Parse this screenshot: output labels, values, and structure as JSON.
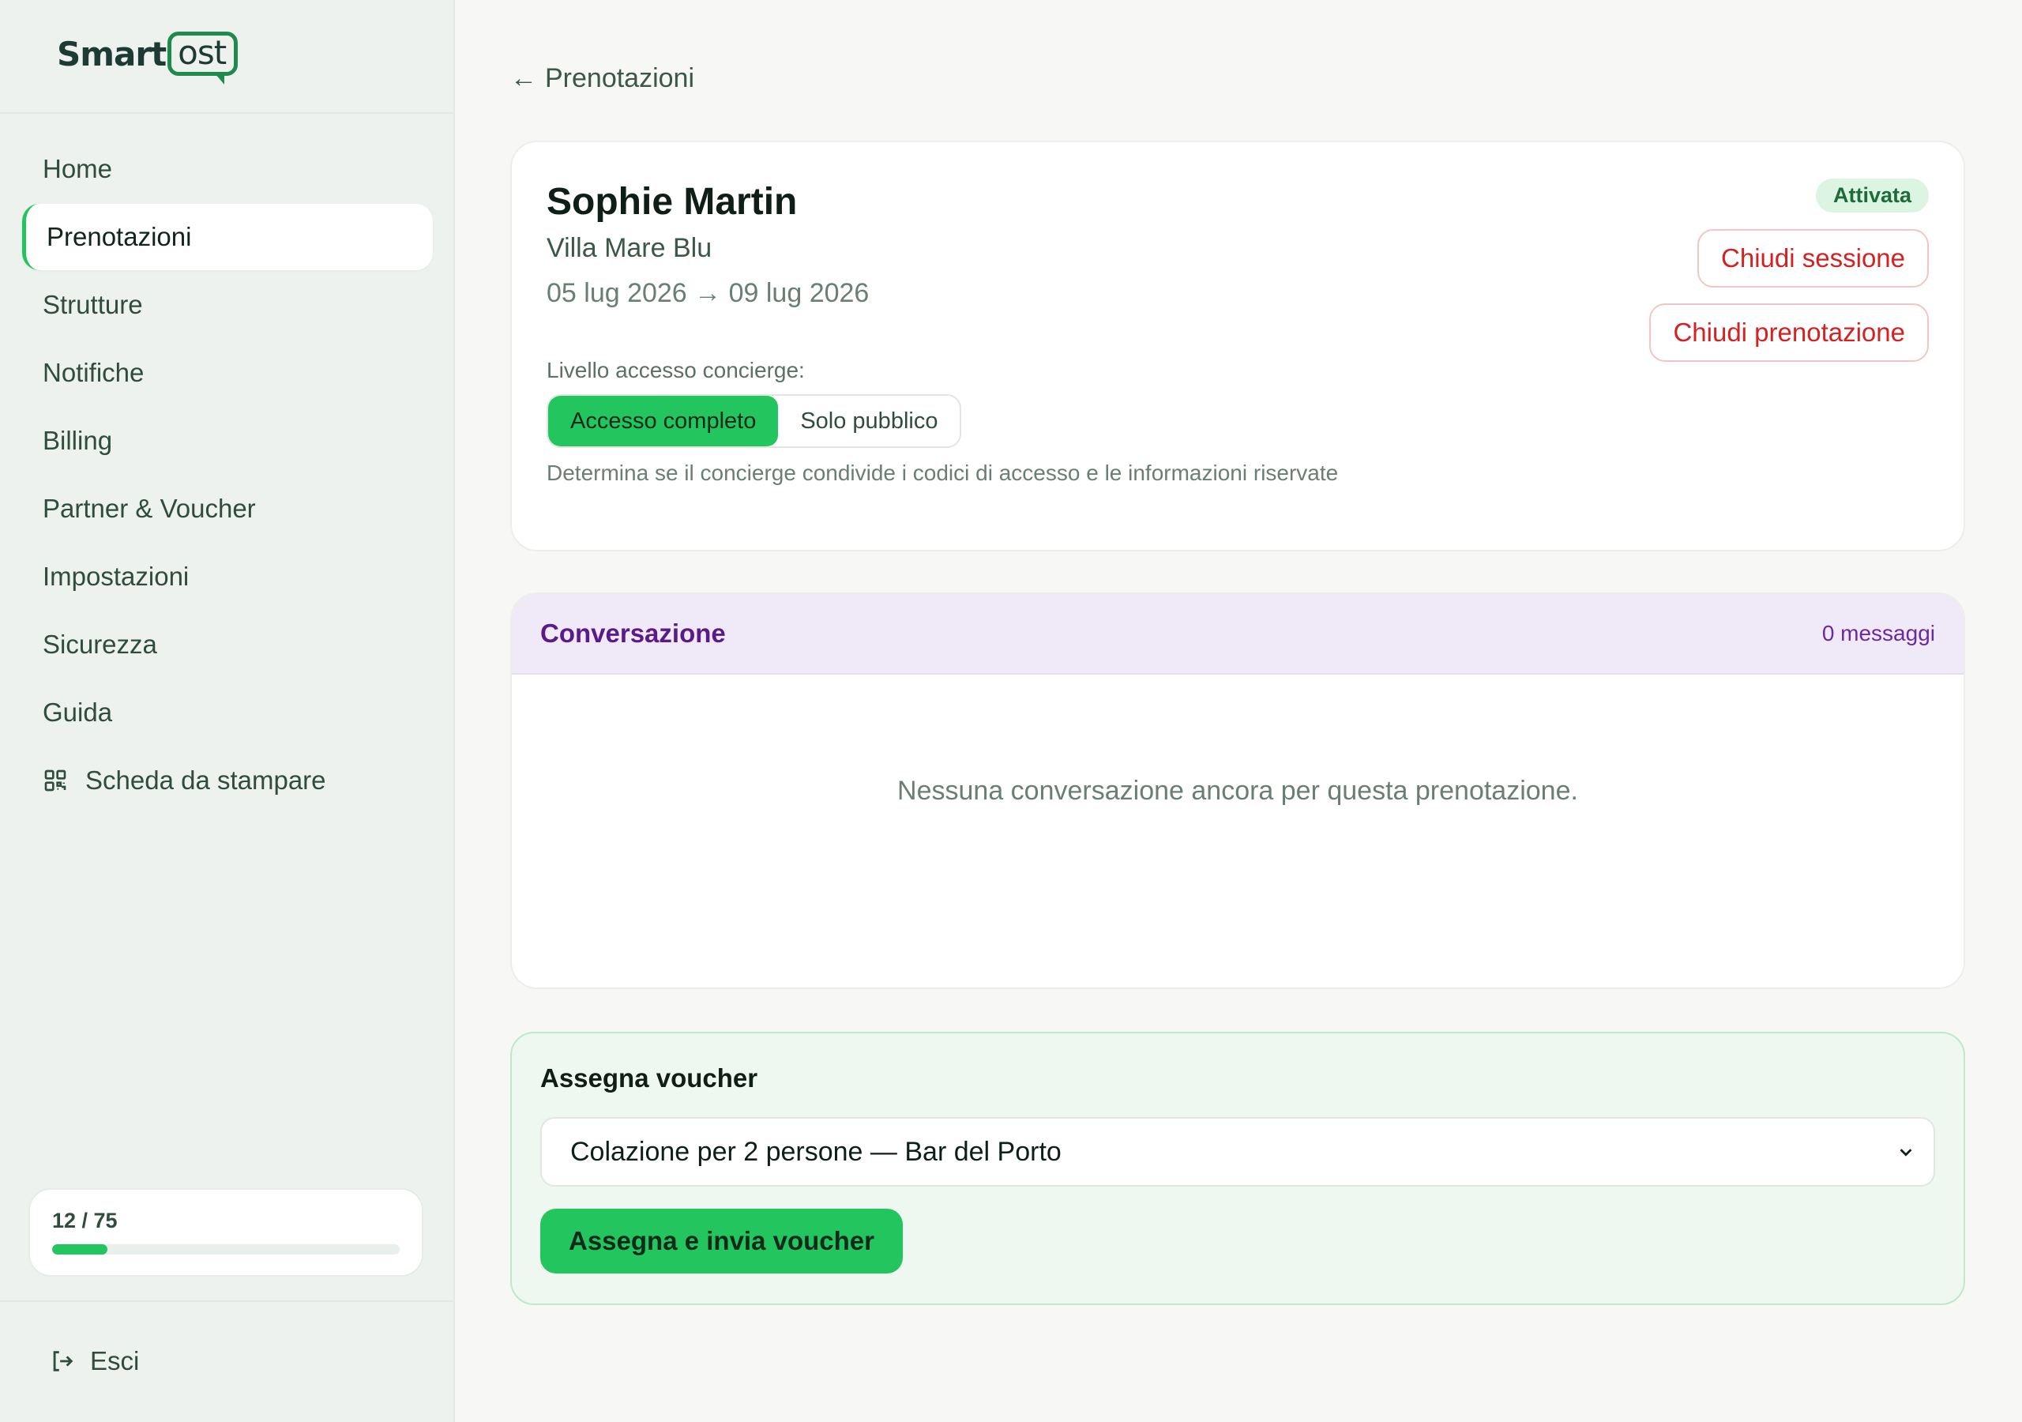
{
  "brand": {
    "name_prefix": "Smart",
    "name_suffix": "ost"
  },
  "sidebar": {
    "items": [
      {
        "label": "Home"
      },
      {
        "label": "Prenotazioni",
        "active": true
      },
      {
        "label": "Strutture"
      },
      {
        "label": "Notifiche"
      },
      {
        "label": "Billing"
      },
      {
        "label": "Partner & Voucher"
      },
      {
        "label": "Impostazioni"
      },
      {
        "label": "Sicurezza"
      },
      {
        "label": "Guida"
      },
      {
        "label": "Scheda da stampare",
        "icon": "qr-code-icon"
      }
    ],
    "quota": {
      "text": "12 / 75",
      "used": 12,
      "total": 75
    },
    "logout_label": "Esci"
  },
  "back_link": {
    "label": "Prenotazioni"
  },
  "booking": {
    "guest_name": "Sophie Martin",
    "property": "Villa Mare Blu",
    "dates": "05 lug 2026 → 09 lug 2026",
    "status": "Attivata",
    "close_session_label": "Chiudi sessione",
    "close_booking_label": "Chiudi prenotazione",
    "access_label": "Livello accesso concierge:",
    "access_options": [
      "Accesso completo",
      "Solo pubblico"
    ],
    "access_help": "Determina se il concierge condivide i codici di accesso e le informazioni riservate"
  },
  "conversation": {
    "title": "Conversazione",
    "count": "0 messaggi",
    "empty": "Nessuna conversazione ancora per questa prenotazione."
  },
  "voucher": {
    "title": "Assegna voucher",
    "selected": "Colazione per 2 persone — Bar del Porto",
    "button_label": "Assegna e invia voucher"
  },
  "colors": {
    "accent": "#22c55e",
    "danger": "#d42121",
    "conversation": "#5b1a8a"
  }
}
